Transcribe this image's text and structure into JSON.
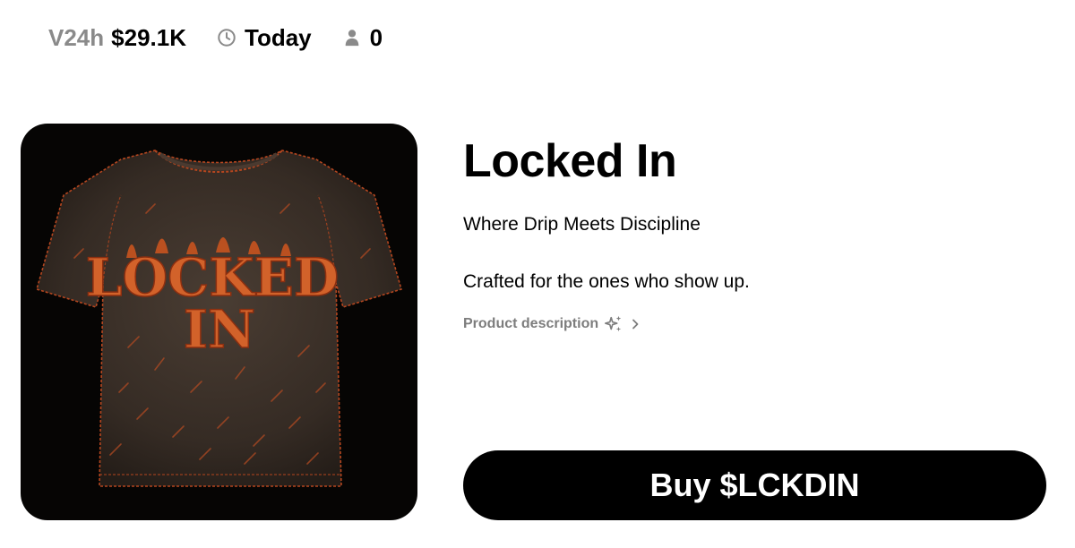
{
  "stats": {
    "volume_label": "V24h",
    "volume_value": "$29.1K",
    "time_icon": "clock-icon",
    "time_value": "Today",
    "holders_icon": "person-icon",
    "holders_value": "0"
  },
  "product": {
    "image_alt": "Locked In t-shirt",
    "shirt_print": [
      "LOCKED",
      "IN"
    ],
    "title": "Locked In",
    "tagline": "Where Drip Meets Discipline",
    "description": "Crafted for the ones who show up.",
    "description_link": "Product description",
    "description_icons": [
      "sparkle-icon",
      "chevron-right-icon"
    ]
  },
  "actions": {
    "buy_label": "Buy $LCKDIN"
  },
  "colors": {
    "background": "#ffffff",
    "text": "#000000",
    "muted": "#8a8a8a",
    "button_bg": "#000000",
    "button_text": "#ffffff",
    "image_bg": "#060504",
    "shirt": "#3a3029",
    "print": "#d2622a"
  }
}
